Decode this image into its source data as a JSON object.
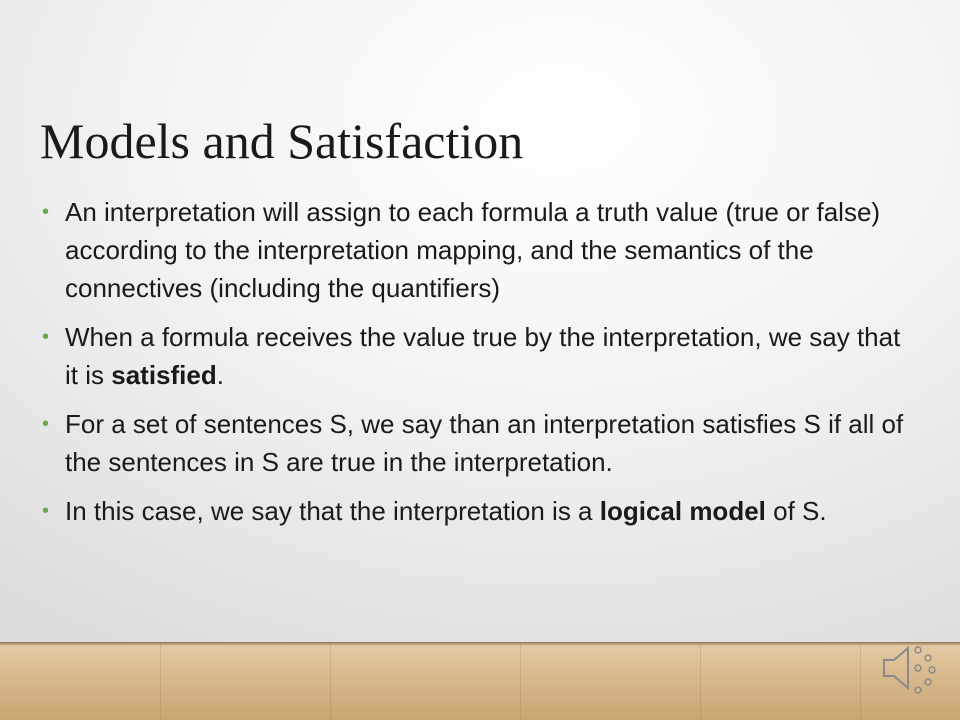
{
  "slide": {
    "title": "Models and Satisfaction",
    "bullets": [
      {
        "text": "An interpretation will assign to each formula a truth value (true or false) according to the interpretation mapping, and the semantics of the connectives (including the quantifiers)"
      },
      {
        "before": "When a formula receives the value true by the interpretation, we say that it is ",
        "bold": "satisfied",
        "after": "."
      },
      {
        "text": "For a set of sentences S, we say than an interpretation satisfies S if all of the sentences in S are true in the interpretation."
      },
      {
        "before": "In this case, we say that the interpretation is a ",
        "bold": "logical model",
        "after": " of S."
      }
    ]
  },
  "icons": {
    "audio": "speaker-icon"
  },
  "colors": {
    "bullet": "#6aa84f",
    "text": "#1a1a1a"
  }
}
